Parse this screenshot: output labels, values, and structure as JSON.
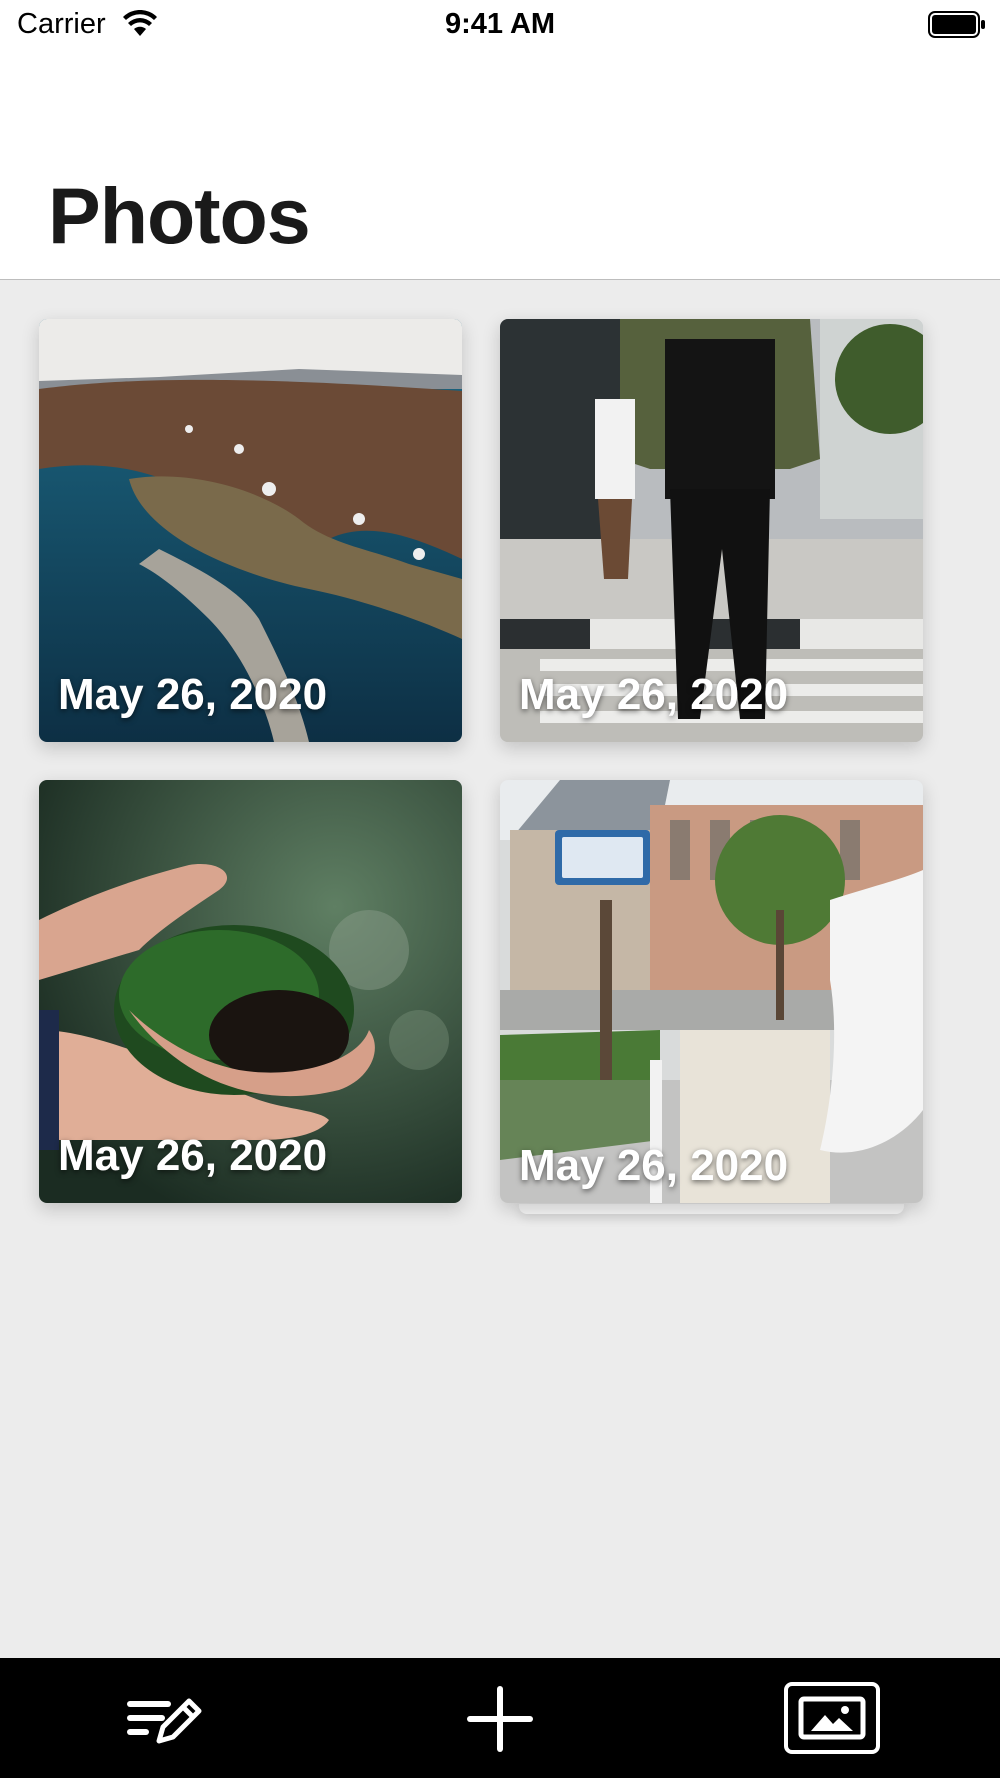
{
  "status_bar": {
    "carrier": "Carrier",
    "time": "9:41 AM",
    "wifi_icon": "wifi-icon",
    "battery_icon": "battery-icon"
  },
  "header": {
    "title": "Photos"
  },
  "photos": [
    {
      "date": "May 26, 2020",
      "subject": "coastal town aerial view"
    },
    {
      "date": "May 26, 2020",
      "subject": "person crossing street"
    },
    {
      "date": "May 26, 2020",
      "subject": "hands holding moss"
    },
    {
      "date": "May 26, 2020",
      "subject": "street sign Sanbancho-St."
    }
  ],
  "tab_bar": {
    "items": [
      {
        "icon": "compose-list-icon"
      },
      {
        "icon": "plus-icon"
      },
      {
        "icon": "photo-icon",
        "selected": true
      }
    ]
  },
  "colors": {
    "background": "#ececec",
    "header": "#ffffff",
    "tab_bar": "#000000"
  }
}
